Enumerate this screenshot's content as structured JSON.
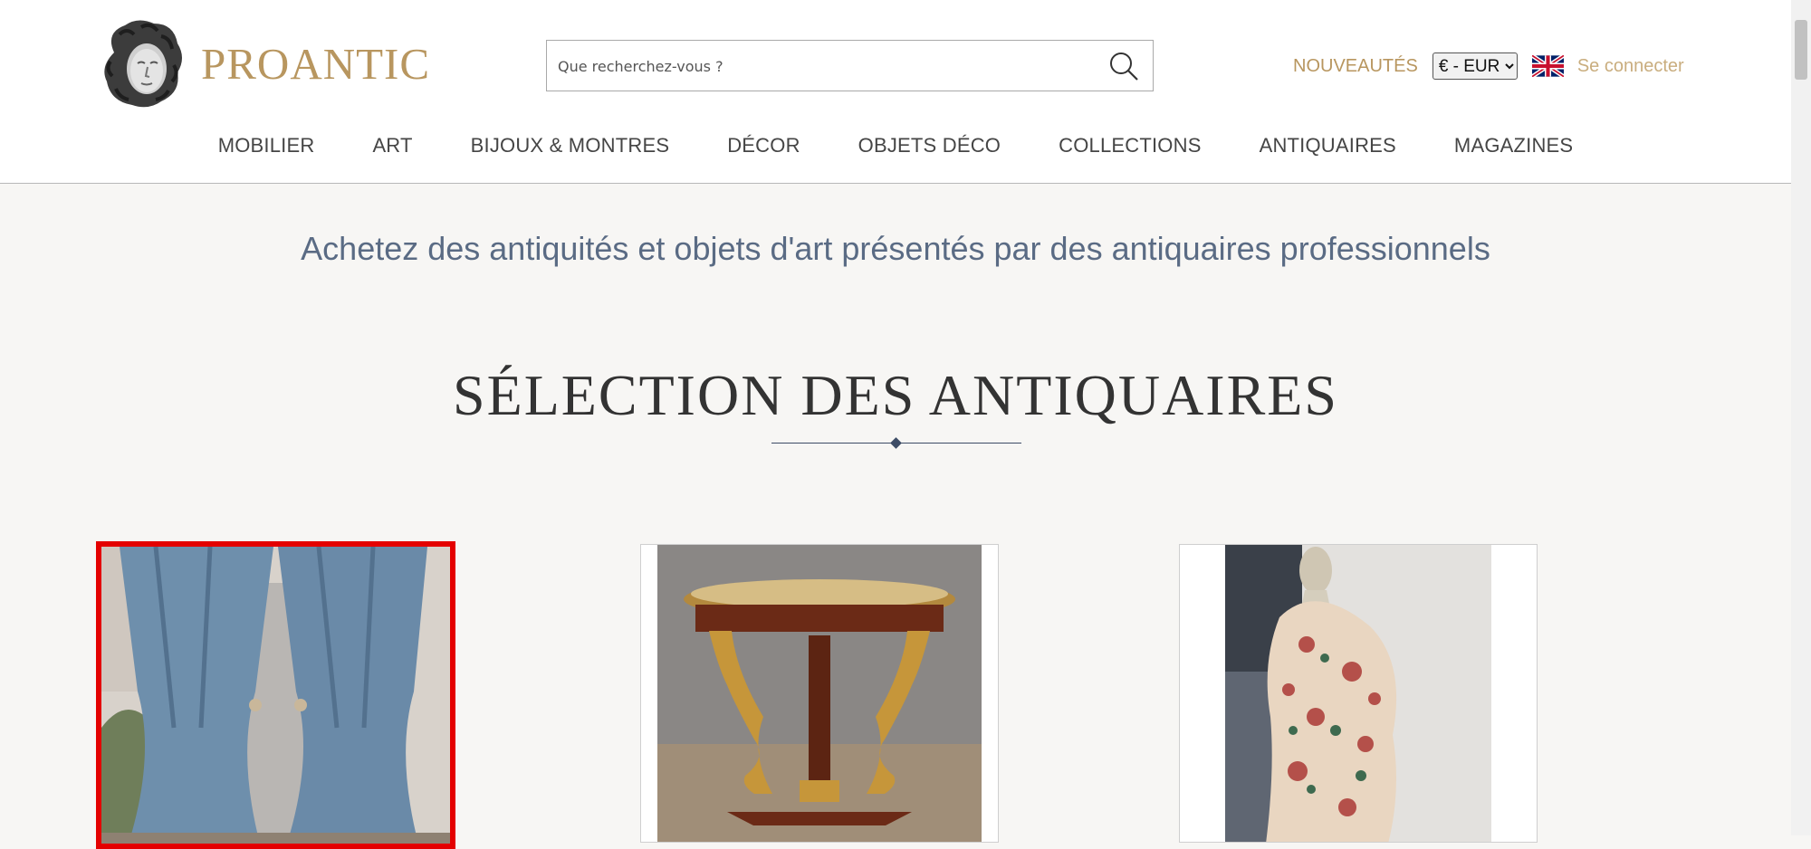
{
  "header": {
    "logo_text": "PROANTIC",
    "search_placeholder": "Que recherchez-vous ?",
    "nouveautes": "NOUVEAUTÉS",
    "currency_selected": "€ - EUR",
    "login": "Se connecter",
    "accent_color": "#b8965f"
  },
  "nav": {
    "items": [
      "MOBILIER",
      "ART",
      "BIJOUX & MONTRES",
      "DÉCOR",
      "OBJETS DÉCO",
      "COLLECTIONS",
      "ANTIQUAIRES",
      "MAGAZINES"
    ]
  },
  "main": {
    "tagline": "Achetez des antiquités et objets d'art présentés par des antiquaires professionnels",
    "section_title": "SÉLECTION DES ANTIQUAIRES"
  },
  "icons": {
    "search": "search-icon",
    "language": "uk-flag-icon",
    "dropdown": "chevron-down-icon"
  }
}
